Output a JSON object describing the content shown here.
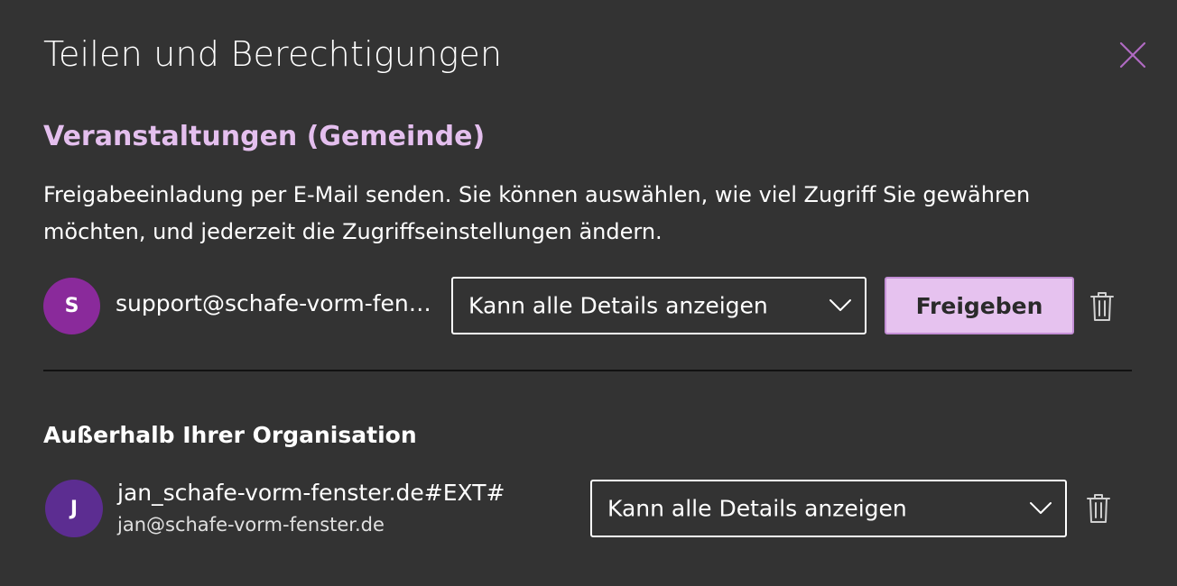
{
  "dialog": {
    "title": "Teilen und Berechtigungen",
    "close_icon": "close-icon",
    "accent_color": "#e4bfee"
  },
  "calendar": {
    "name": "Veranstaltungen (Gemeinde)"
  },
  "description": "Freigabeeinladung per E-Mail senden. Sie können auswählen, wie viel Zugriff Sie gewähren möchten, und jederzeit die Zugriffseinstellungen ändern.",
  "new_share": {
    "avatar_initial": "S",
    "avatar_color": "#8a2a9b",
    "email": "support@schafe-vorm-fen…",
    "permission": "Kann alle Details anzeigen",
    "share_button": "Freigeben",
    "share_button_color": "#e6c2ef"
  },
  "outside_org": {
    "heading": "Außerhalb Ihrer Organisation",
    "members": [
      {
        "avatar_initial": "J",
        "avatar_color": "#5c2d91",
        "name": "jan_schafe-vorm-fenster.de#EXT#",
        "email": "jan@schafe-vorm-fenster.de",
        "permission": "Kann alle Details anzeigen"
      }
    ]
  }
}
